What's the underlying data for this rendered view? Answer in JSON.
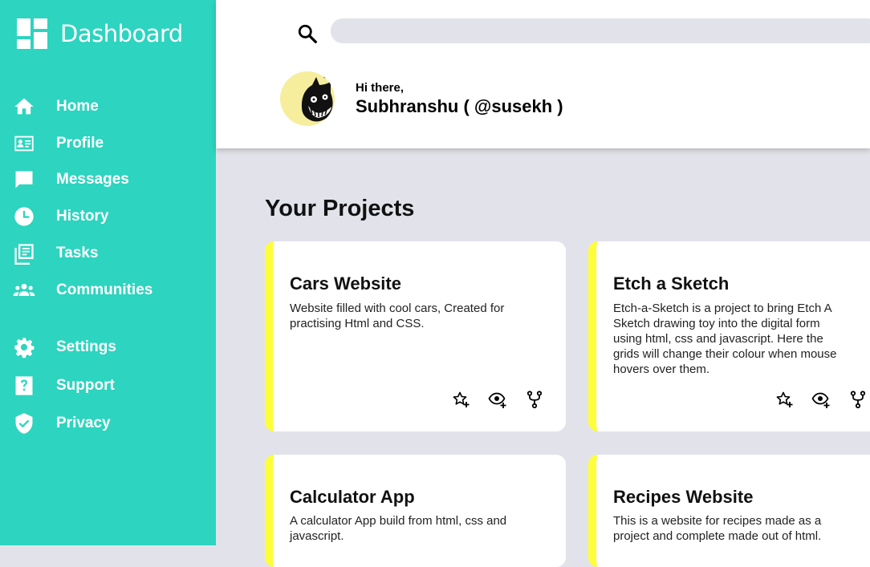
{
  "brand": {
    "title": "Dashboard"
  },
  "nav": [
    {
      "label": "Home",
      "icon": "home-icon"
    },
    {
      "label": "Profile",
      "icon": "id-card-icon"
    },
    {
      "label": "Messages",
      "icon": "message-icon"
    },
    {
      "label": "History",
      "icon": "clock-icon"
    },
    {
      "label": "Tasks",
      "icon": "tasks-icon"
    },
    {
      "label": "Communities",
      "icon": "people-icon"
    },
    {
      "label": "Settings",
      "icon": "gear-icon"
    },
    {
      "label": "Support",
      "icon": "help-icon"
    },
    {
      "label": "Privacy",
      "icon": "shield-icon"
    }
  ],
  "header": {
    "search": {
      "placeholder": ""
    },
    "greeting": "Hi there,",
    "username": "Subhranshu ( @susekh )"
  },
  "main": {
    "title": "Your Projects",
    "projects": [
      {
        "title": "Cars Website",
        "description": "Website filled with cool cars, Created for practising Html and CSS."
      },
      {
        "title": "Etch a Sketch",
        "description": "Etch-a-Sketch is a project to bring Etch A Sketch drawing toy into the digital form using html, css and javascript. Here the grids will change their colour when mouse hovers over them."
      },
      {
        "title": "Calculator App",
        "description": "A calculator App build from html, css and javascript."
      },
      {
        "title": "Recipes Website",
        "description": "This is a website for recipes made as a project and complete made out of html."
      }
    ]
  },
  "colors": {
    "sidebar": "#2dd4bf",
    "accent": "#fdfd3a",
    "background": "#e2e3ea"
  }
}
